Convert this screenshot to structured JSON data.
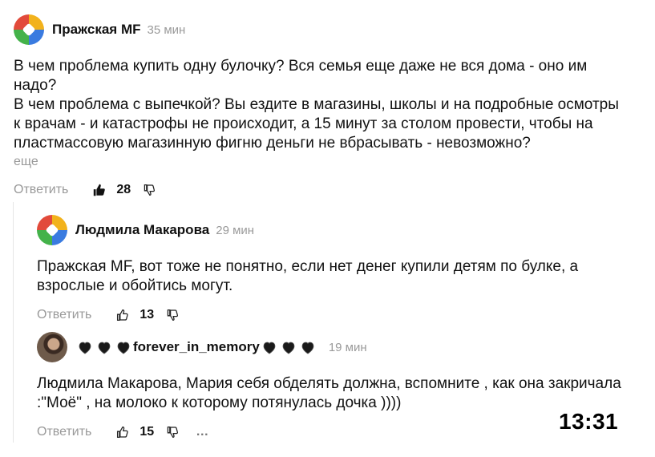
{
  "comments": [
    {
      "author": "Пражская MF",
      "time": "35 мин",
      "text_lines": [
        "В чем проблема купить одну булочку? Вся семья еще даже не вся дома - оно им",
        "надо?",
        "В чем проблема с выпечкой? Вы ездите в магазины, школы и на подробные осмотры",
        "к врачам - и катастрофы не происходит, а 15 минут за столом провести, чтобы на",
        "пластмассовую магазинную фигню деньги не вбрасывать - невозможно?"
      ],
      "more_label": "еще",
      "reply_label": "Ответить",
      "likes": "28",
      "avatar": "logo-avatar"
    },
    {
      "author": "Людмила Макарова",
      "time": "29 мин",
      "text_lines": [
        "Пражская MF, вот тоже не понятно, если нет денег купили детям по булке, а",
        "взрослые и обойтись могут."
      ],
      "reply_label": "Ответить",
      "likes": "13",
      "avatar": "logo-avatar"
    },
    {
      "author": "forever_in_memory",
      "time": "19 мин",
      "text_lines": [
        "Людмила Макарова, Мария себя обделять должна, вспомните , как она закричала",
        ":\"Моё\" , на молоко к которому потянулась дочка ))))"
      ],
      "reply_label": "Ответить",
      "likes": "15",
      "more_icon": "…",
      "avatar": "photo-avatar",
      "name_decoration": "black-heart-icon"
    }
  ],
  "status": {
    "clock": "13:31"
  },
  "colors": {
    "muted": "#999999",
    "text": "#111111"
  }
}
